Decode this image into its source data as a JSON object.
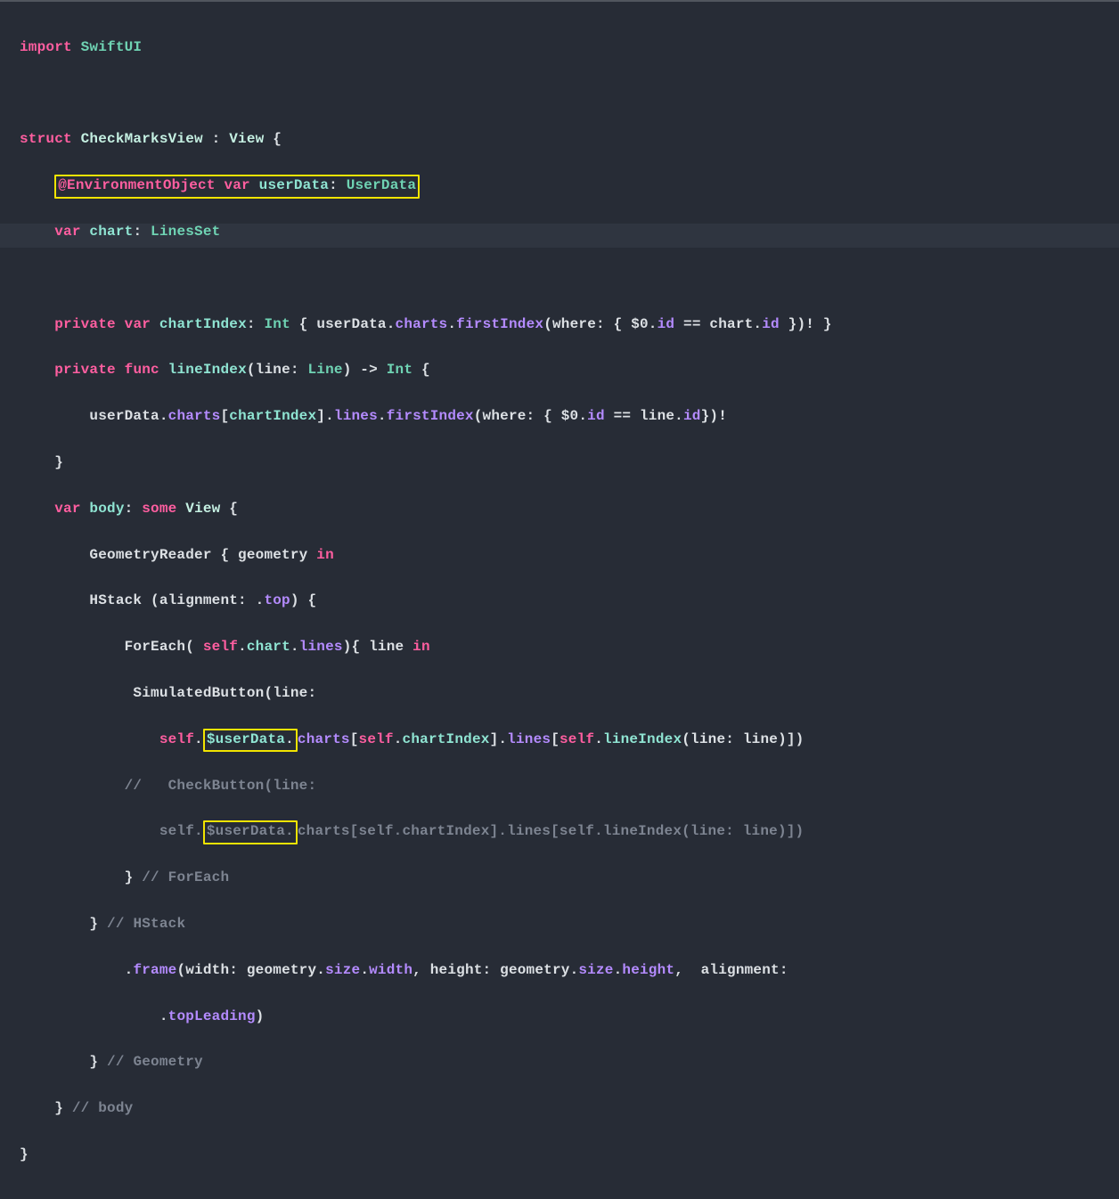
{
  "code": {
    "l1": {
      "a": "import",
      "b": " SwiftUI"
    },
    "l3": {
      "a": "struct",
      "b": " CheckMarksView",
      "c": " :",
      "d": " View",
      "e": " {"
    },
    "l4": {
      "a": "@EnvironmentObject",
      "b": " var",
      "c": " userData",
      "d": ":",
      "e": " UserData"
    },
    "l5": {
      "a": "var",
      "b": " chart",
      "c": ":",
      "d": " LinesSet"
    },
    "l7": {
      "a": "private",
      "b": " var",
      "c": " chartIndex",
      "d": ":",
      "e": " Int",
      "f": " { userData.",
      "g": "charts",
      "h": ".",
      "i": "firstIndex",
      "j": "(where: { $0.",
      "k": "id",
      "l": " == chart.",
      "m": "id",
      "n": " })! }"
    },
    "l8": {
      "a": "private",
      "b": " func",
      "c": " lineIndex",
      "d": "(line:",
      "e": " Line",
      "f": ") ->",
      "g": " Int",
      "h": " {"
    },
    "l9": {
      "a": "userData.",
      "b": "charts",
      "c": "[",
      "d": "chartIndex",
      "e": "].",
      "f": "lines",
      "g": ".",
      "h": "firstIndex",
      "i": "(where: { $0.",
      "j": "id",
      "k": " == line.",
      "l": "id",
      "m": "})!"
    },
    "l10": {
      "a": "}"
    },
    "l11": {
      "a": "var",
      "b": " body",
      "c": ":",
      "d": " some",
      "e": " View",
      "f": " {"
    },
    "l12": {
      "a": "GeometryReader { geometry",
      "b": " in"
    },
    "l13": {
      "a": "HStack (alignment: .",
      "b": "top",
      "c": ") {"
    },
    "l14": {
      "a": "ForEach(",
      "b": " self",
      "c": ".",
      "d": "chart",
      "e": ".",
      "f": "lines",
      "g": "){ line",
      "h": " in"
    },
    "l15": {
      "a": "SimulatedButton(line:"
    },
    "l16": {
      "a": "self",
      "b": ".",
      "c": "$userData",
      "d": ".",
      "e": "charts",
      "f": "[",
      "g": "self",
      "h": ".",
      "i": "chartIndex",
      "j": "].",
      "k": "lines",
      "l": "[",
      "m": "self",
      "n": ".",
      "o": "lineIndex",
      "p": "(line: line)])"
    },
    "l17": {
      "a": "//   CheckButton(line:"
    },
    "l18": {
      "a": "self.",
      "b": "$userData.",
      "c": "charts[self.chartIndex].lines[self.lineIndex(line: line)])"
    },
    "l19": {
      "a": "}",
      "b": " // ForEach"
    },
    "l20": {
      "a": "}",
      "b": " // HStack"
    },
    "l21": {
      "a": ".",
      "b": "frame",
      "c": "(width: geometry.",
      "d": "size",
      "e": ".",
      "f": "width",
      "g": ", height: geometry.",
      "h": "size",
      "i": ".",
      "j": "height",
      "k": ",  alignment:"
    },
    "l22": {
      "a": ".",
      "b": "topLeading",
      "c": ")"
    },
    "l23": {
      "a": "}",
      "b": " // Geometry"
    },
    "l24": {
      "a": "}",
      "b": " // body"
    },
    "l25": {
      "a": "}"
    }
  },
  "highlights": {
    "box1": "line 4 @EnvironmentObject declaration",
    "box2": "$userData.",
    "box3": "$userData."
  }
}
